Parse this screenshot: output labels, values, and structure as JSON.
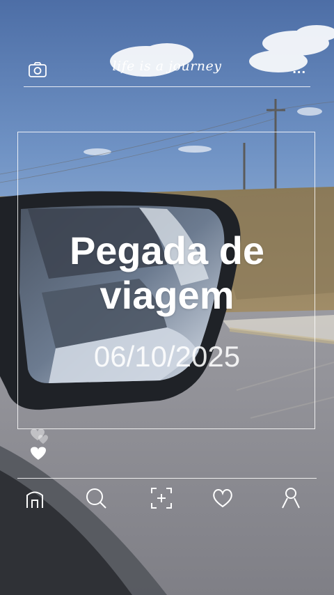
{
  "header": {
    "brand": "life is a journey",
    "camera_icon": "camera-icon",
    "more_icon": "more-dots-icon",
    "more_label": "..."
  },
  "card": {
    "title_line1": "Pegada de",
    "title_line2": "viagem",
    "date": "06/10/2025"
  },
  "nav": {
    "items": [
      {
        "icon": "home-icon"
      },
      {
        "icon": "search-icon"
      },
      {
        "icon": "add-photo-icon"
      },
      {
        "icon": "heart-icon"
      },
      {
        "icon": "profile-icon"
      }
    ]
  },
  "colors": {
    "sky_top": "#4f6fa4",
    "sky_mid": "#7fa3cf",
    "road": "#8f8f92",
    "mirror_frame": "#1e2126",
    "mirror_glass": "#6b7f98"
  }
}
